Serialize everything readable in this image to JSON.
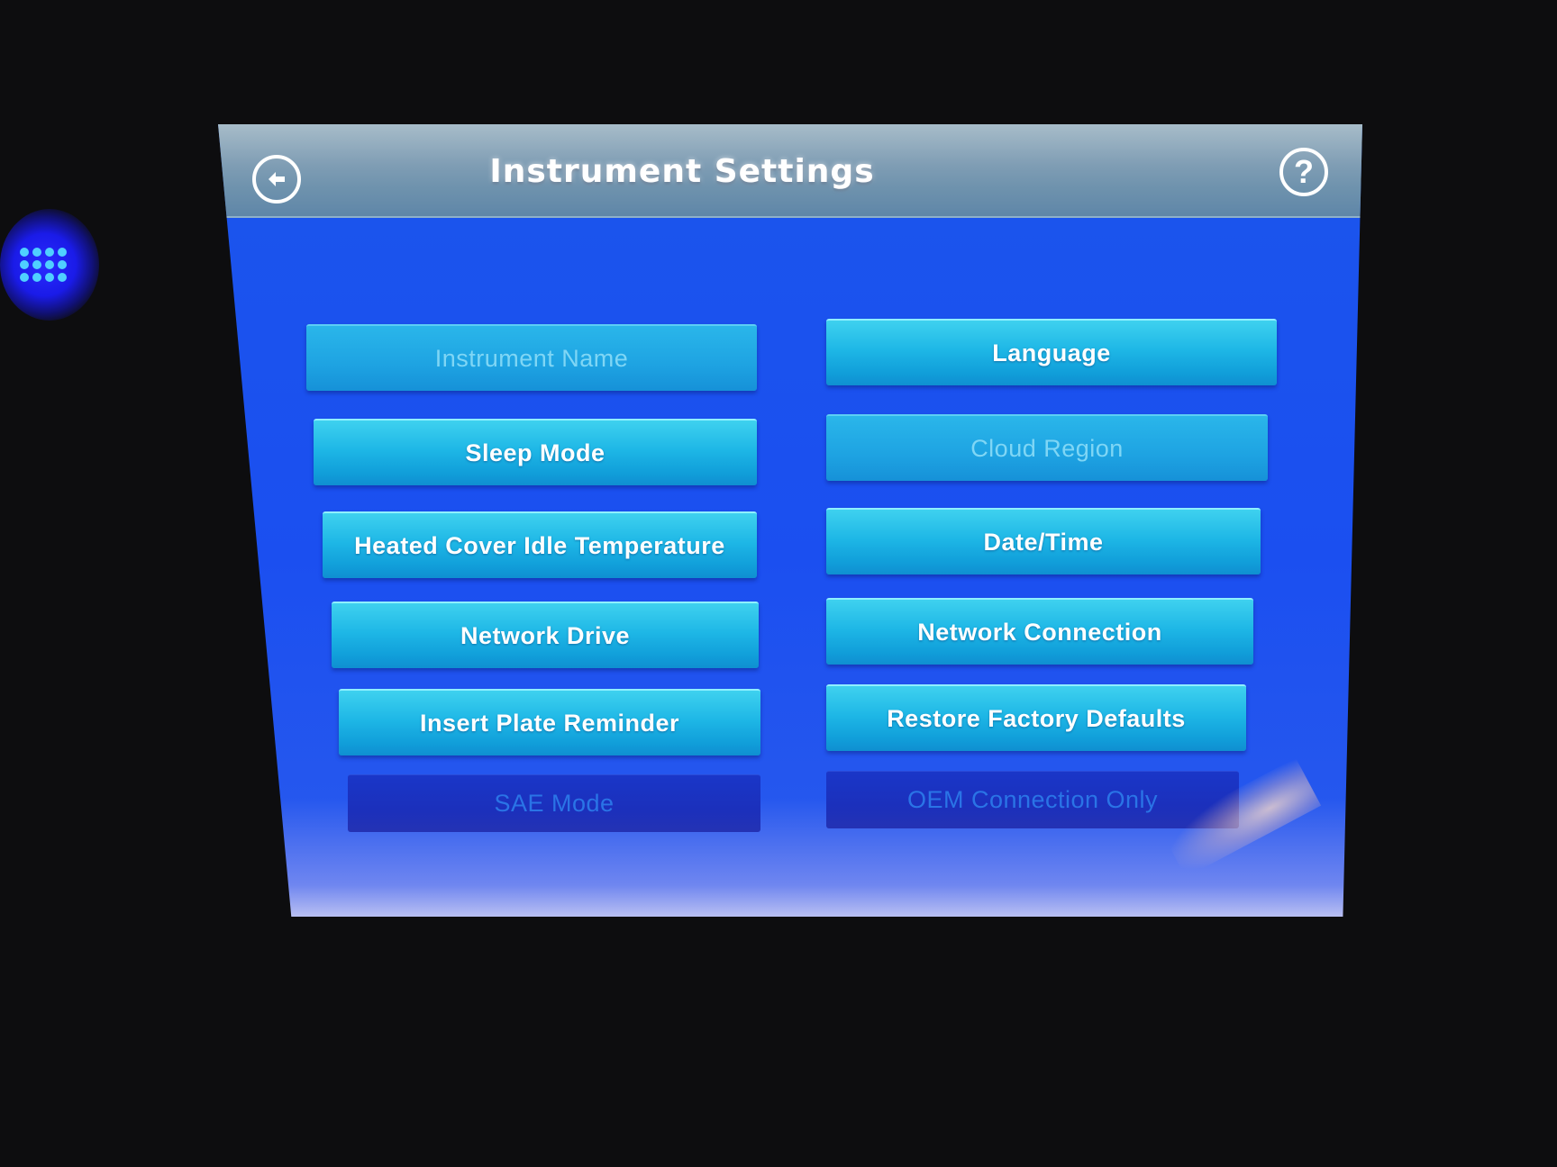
{
  "header": {
    "title": "Instrument Settings",
    "back_icon": "back-arrow-icon",
    "help_symbol": "?"
  },
  "bezel": {
    "keypad_icon": "keypad-grid-icon",
    "accent": "#2a2bff",
    "dot_color": "#4fd0ff"
  },
  "buttons": {
    "instrument_name": "Instrument Name",
    "language": "Language",
    "sleep_mode": "Sleep Mode",
    "cloud_region": "Cloud Region",
    "heated_cover": "Heated Cover Idle Temperature",
    "date_time": "Date/Time",
    "network_drive": "Network Drive",
    "network_connection": "Network Connection",
    "insert_plate_reminder": "Insert Plate Reminder",
    "restore_factory_defaults": "Restore Factory Defaults",
    "sae_mode": "SAE Mode",
    "oem_connection_only": "OEM Connection Only"
  },
  "colors": {
    "screen_bg": "#1b55ec",
    "button_active": "#1eb7e6",
    "button_disabled_text": "#7fd6f5",
    "button_unavailable": "#1b30bc"
  }
}
